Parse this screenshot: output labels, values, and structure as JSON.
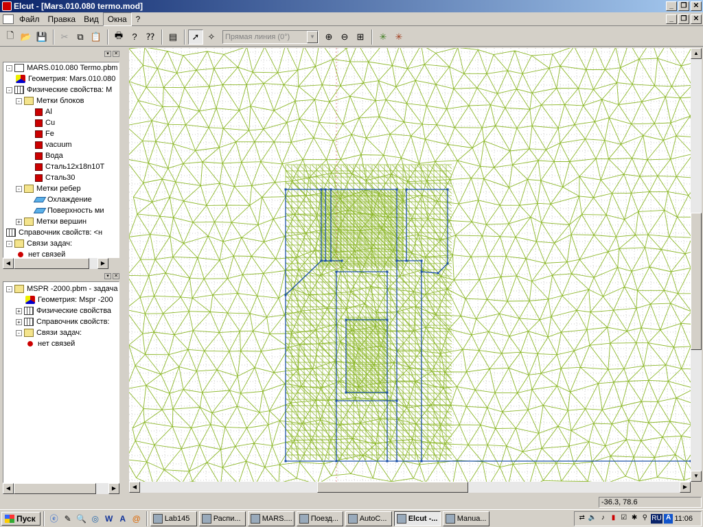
{
  "window": {
    "title": "Elcut - [Mars.010.080 termo.mod]"
  },
  "menu": {
    "items": [
      "Файл",
      "Правка",
      "Вид",
      "Окна",
      "?"
    ]
  },
  "toolbar": {
    "line_type_value": "Прямая линия (0°)"
  },
  "tree1": {
    "items": [
      {
        "label": "MARS.010.080 Termo.pbm -",
        "icon": "doc-icon"
      },
      {
        "label": "Геометрия: Mars.010.080",
        "icon": "geometry-icon"
      },
      {
        "label": "Физические свойства: M",
        "icon": "grid-icon"
      },
      {
        "label": "Метки блоков",
        "icon": "folder-icon"
      },
      {
        "label": "Al",
        "icon": "block-label-icon"
      },
      {
        "label": "Cu",
        "icon": "block-label-icon"
      },
      {
        "label": "Fe",
        "icon": "block-label-icon"
      },
      {
        "label": "vacuum",
        "icon": "block-label-icon"
      },
      {
        "label": "Вода",
        "icon": "block-label-icon"
      },
      {
        "label": "Сталь12х18n10T",
        "icon": "block-label-icon"
      },
      {
        "label": "Сталь30",
        "icon": "block-label-icon"
      },
      {
        "label": "Метки ребер",
        "icon": "folder-icon"
      },
      {
        "label": "Охлаждение",
        "icon": "edge-label-icon"
      },
      {
        "label": "Поверхность ми",
        "icon": "edge-label-icon"
      },
      {
        "label": "Метки вершин",
        "icon": "folder-icon"
      },
      {
        "label": "Справочник свойств: <н",
        "icon": "grid-icon"
      },
      {
        "label": "Связи задач:",
        "icon": "folder-icon"
      },
      {
        "label": "нет связей",
        "icon": "link-icon"
      }
    ]
  },
  "tree2": {
    "items": [
      {
        "label": "MSPR -2000.pbm - задача",
        "icon": "folder-icon"
      },
      {
        "label": "Геометрия: Mspr -200",
        "icon": "geometry-icon"
      },
      {
        "label": "Физические свойства",
        "icon": "grid-icon"
      },
      {
        "label": "Справочник свойств:",
        "icon": "grid-icon"
      },
      {
        "label": "Связи задач:",
        "icon": "folder-icon"
      },
      {
        "label": "нет связей",
        "icon": "link-icon"
      }
    ]
  },
  "status": {
    "coords": "-36.3, 78.6"
  },
  "taskbar": {
    "start": "Пуск",
    "tasks": [
      "Lab145",
      "Распи...",
      "MARS....",
      "Поезд...",
      "AutoC...",
      "Elcut -...",
      "Manua..."
    ],
    "lang": "RU",
    "clock": "11:06"
  },
  "colors": {
    "mesh": "#8db82a",
    "geometry": "#1a4fa8",
    "grid_dots": "#9a9a9a"
  }
}
